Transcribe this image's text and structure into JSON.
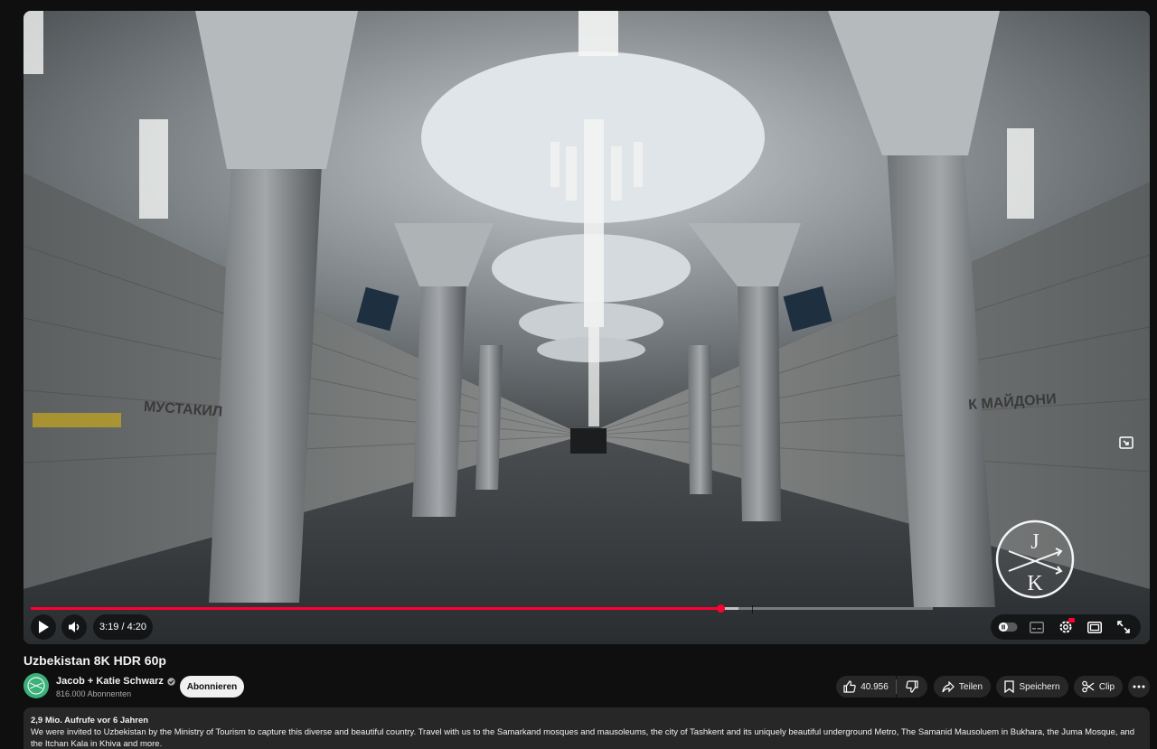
{
  "player": {
    "time_display": "3:19 / 4:20",
    "progress": 0.765,
    "buffered": 0.785,
    "colors": {
      "progress": "#ff0033"
    },
    "icons": [
      "play-icon",
      "volume-icon",
      "autoplay-toggle-icon",
      "subtitles-icon",
      "settings-icon",
      "hd-badge-icon",
      "miniplayer-icon",
      "theater-mode-icon",
      "fullscreen-icon",
      "channel-watermark-icon"
    ]
  },
  "video": {
    "title": "Uzbekistan 8K HDR 60p",
    "scene_sign_left": "МУСТАКИЛ",
    "scene_sign_right": "К МАЙДОНИ",
    "watermark_letters": [
      "J",
      "K"
    ]
  },
  "channel": {
    "name": "Jacob + Katie Schwarz",
    "subscribers": "816.000 Abonnenten",
    "subscribe_label": "Abonnieren",
    "avatar_color": "#3bb07a",
    "verified_icon": "verified-check-icon"
  },
  "actions": {
    "like_count": "40.956",
    "share_label": "Teilen",
    "save_label": "Speichern",
    "clip_label": "Clip"
  },
  "description": {
    "meta": "2,9 Mio. Aufrufe  vor 6 Jahren",
    "text": "We were invited to Uzbekistan by the Ministry of Tourism to capture this diverse and beautiful country. Travel with us to the Samarkand mosques and mausoleums,  the city of Tashkent and its uniquely beautiful underground Metro, The Samanid Mausoluem in Bukhara, the Juma Mosque, and the Itchan Kala in Khiva and more."
  }
}
